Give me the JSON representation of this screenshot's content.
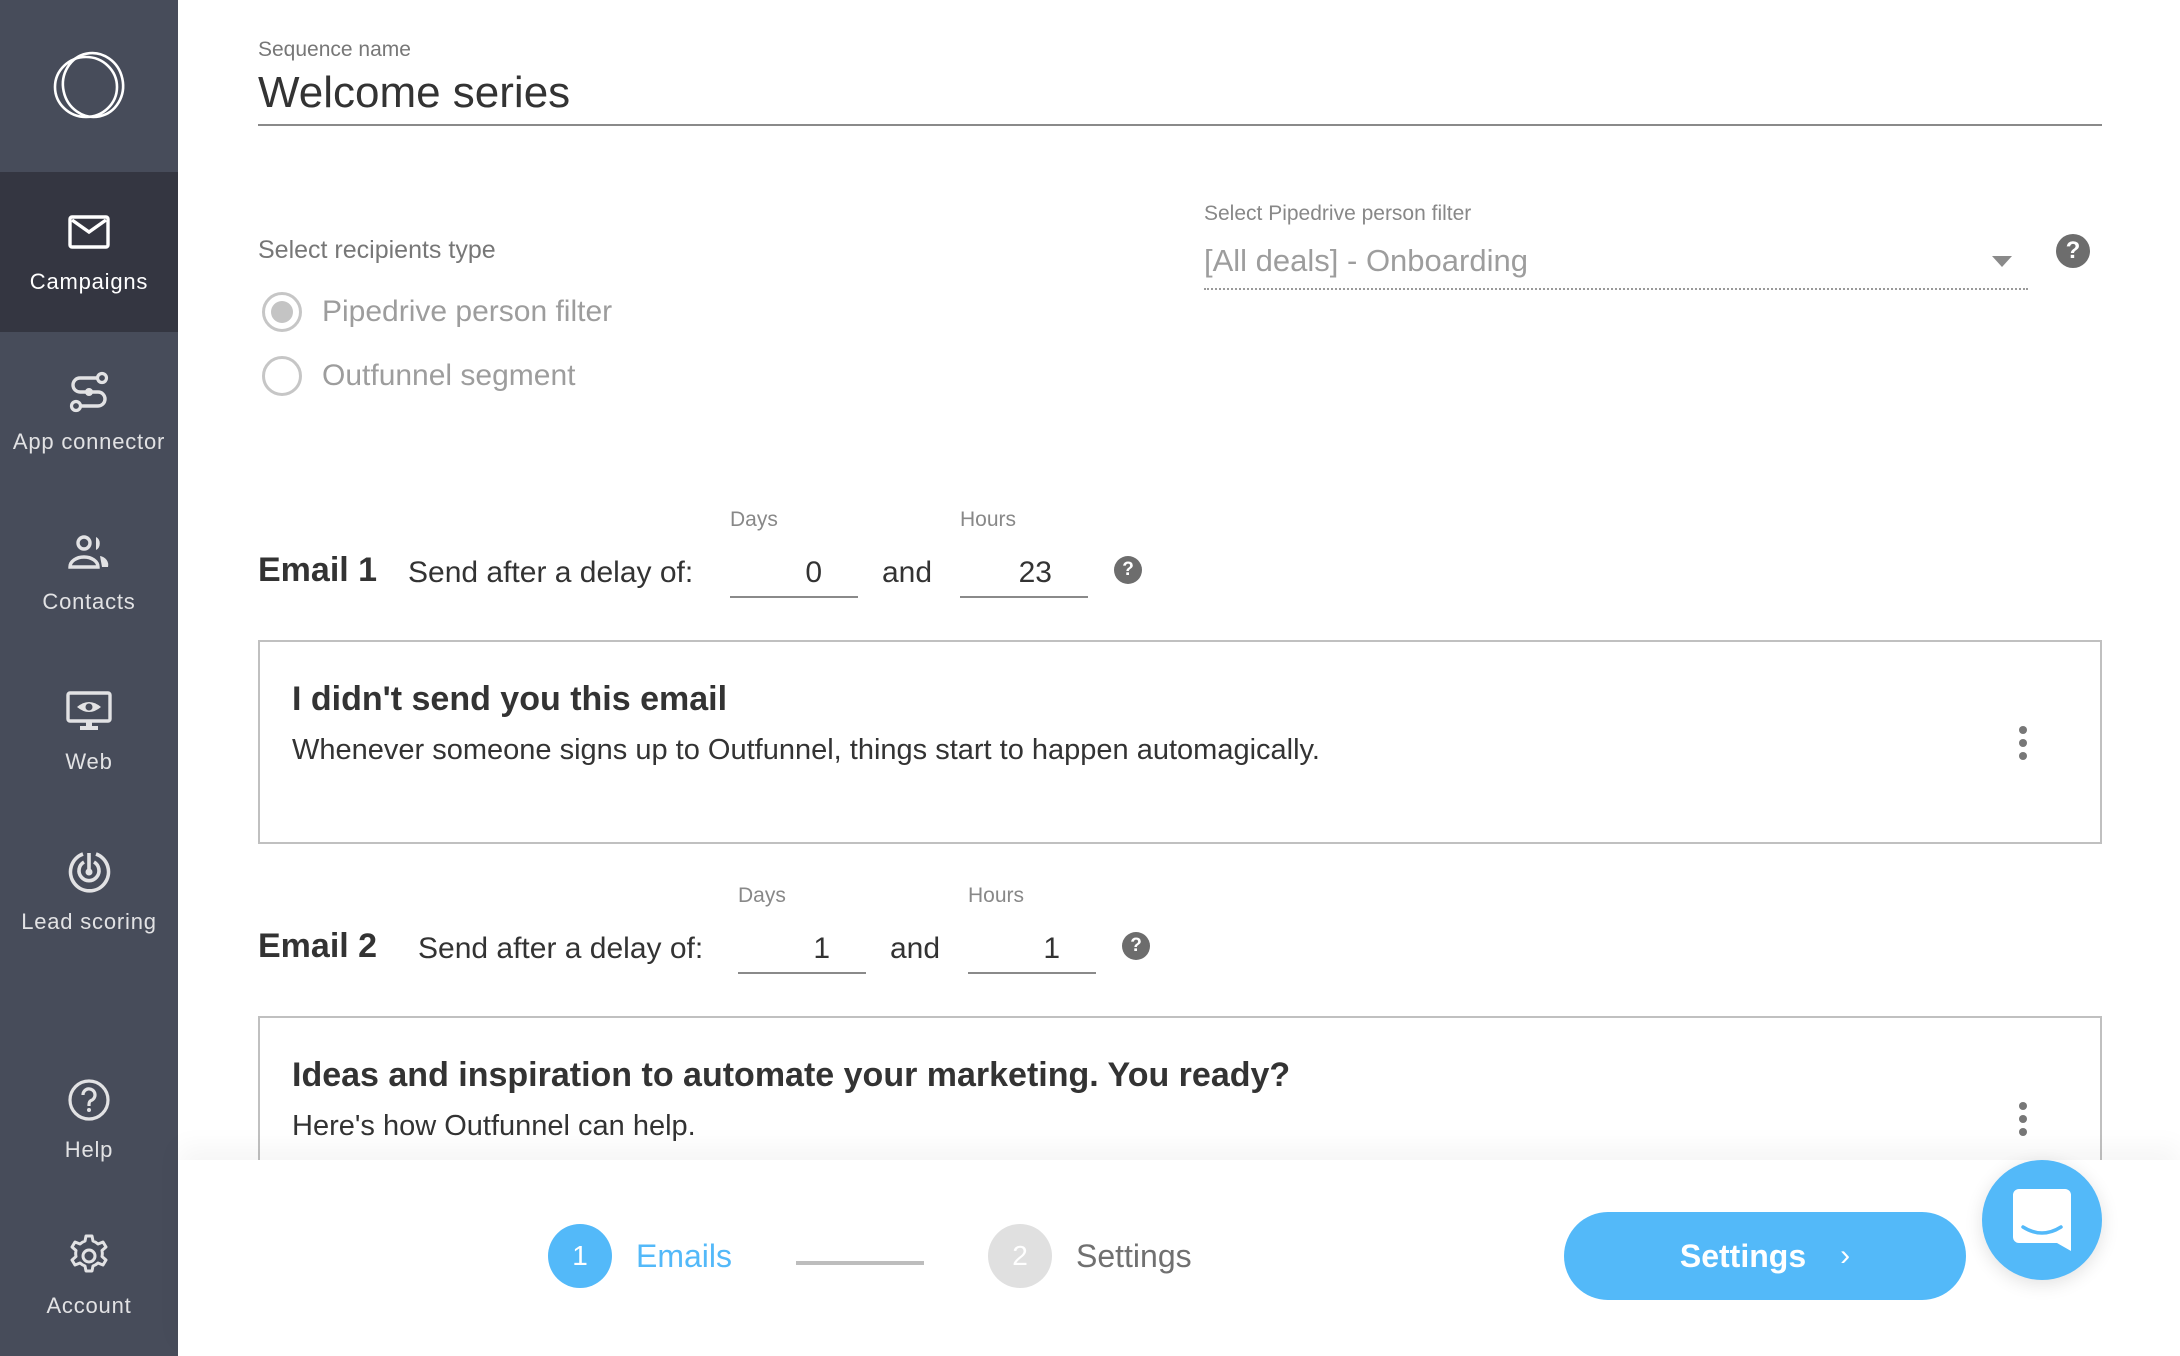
{
  "sidebar": {
    "logo": "outfunnel-logo",
    "items": [
      {
        "label": "Campaigns",
        "icon": "envelope-icon",
        "active": true
      },
      {
        "label": "App connector",
        "icon": "connector-icon",
        "active": false
      },
      {
        "label": "Contacts",
        "icon": "contacts-icon",
        "active": false
      },
      {
        "label": "Web",
        "icon": "monitor-eye-icon",
        "active": false
      },
      {
        "label": "Lead scoring",
        "icon": "target-icon",
        "active": false
      },
      {
        "label": "Help",
        "icon": "question-circle-icon",
        "active": false
      },
      {
        "label": "Account",
        "icon": "gear-icon",
        "active": false
      }
    ]
  },
  "sequence": {
    "label": "Sequence name",
    "value": "Welcome series"
  },
  "recipients": {
    "label": "Select recipients type",
    "options": [
      {
        "label": "Pipedrive person filter",
        "selected": true
      },
      {
        "label": "Outfunnel segment",
        "selected": false
      }
    ]
  },
  "filter": {
    "label": "Select Pipedrive person filter",
    "value": "[All deals] - Onboarding",
    "help": "?"
  },
  "emails": [
    {
      "title": "Email 1",
      "delay_text": "Send after a delay of:",
      "days_label": "Days",
      "days": "0",
      "and": "and",
      "hours_label": "Hours",
      "hours": "23",
      "help": "?",
      "subject": "I didn't send you this email",
      "preview": "Whenever someone signs up to Outfunnel, things start to happen automagically."
    },
    {
      "title": "Email 2",
      "delay_text": "Send after a delay of:",
      "days_label": "Days",
      "days": "1",
      "and": "and",
      "hours_label": "Hours",
      "hours": "1",
      "help": "?",
      "subject": "Ideas and inspiration to automate your marketing. You ready?",
      "preview": "Here's how Outfunnel can help."
    }
  ],
  "stepper": {
    "steps": [
      {
        "number": "1",
        "label": "Emails",
        "active": true
      },
      {
        "number": "2",
        "label": "Settings",
        "active": false
      }
    ]
  },
  "next_button": {
    "label": "Settings",
    "chevron": "›"
  },
  "colors": {
    "accent": "#53b9f9",
    "sidebar": "#474c5a",
    "sidebar_active": "#343641"
  }
}
